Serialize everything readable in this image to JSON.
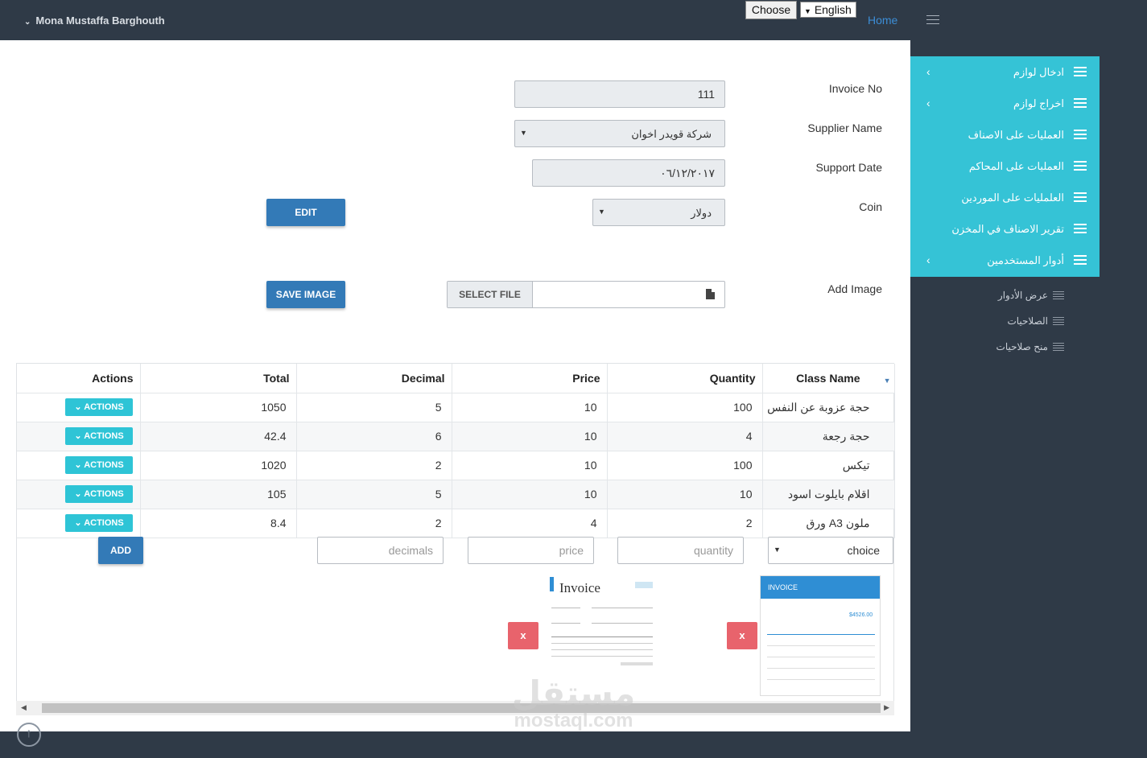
{
  "header": {
    "user_name": "Mona Mustaffa Barghouth",
    "choose_label": "Choose",
    "language": "English",
    "home_label": "Home"
  },
  "sidebar": {
    "items": [
      {
        "label": "ادخال لوازم",
        "has_arrow": true
      },
      {
        "label": "اخراج لوازم",
        "has_arrow": true
      },
      {
        "label": "العمليات على الاصناف",
        "has_arrow": false
      },
      {
        "label": "العمليات على المحاكم",
        "has_arrow": false
      },
      {
        "label": "العلمليات على الموردين",
        "has_arrow": false
      },
      {
        "label": "تقرير الاصناف في المخزن",
        "has_arrow": false
      },
      {
        "label": "أدوار المستخدمين",
        "has_arrow": true
      }
    ],
    "sub_items": [
      {
        "label": "عرض الأدوار"
      },
      {
        "label": "الصلاحيات"
      },
      {
        "label": "منح صلاحيات"
      }
    ]
  },
  "form": {
    "invoice_no_label": "Invoice No",
    "invoice_no_value": "111",
    "supplier_label": "Supplier Name",
    "supplier_value": "شركة قويدر اخوان",
    "date_label": "Support Date",
    "date_value": "٠٦/١٢/٢٠١٧",
    "coin_label": "Coin",
    "coin_value": "دولار",
    "edit_label": "EDIT",
    "add_image_label": "Add Image",
    "select_file_label": "SELECT FILE",
    "save_image_label": "SAVE IMAGE"
  },
  "table": {
    "columns": [
      "Actions",
      "Total",
      "Decimal",
      "Price",
      "Quantity",
      "Class Name"
    ],
    "rows": [
      {
        "actions": "ACTIONS",
        "total": "1050",
        "decimal": "5",
        "price": "10",
        "quantity": "100",
        "class_name": "حجة عزوبة عن النفس"
      },
      {
        "actions": "ACTIONS",
        "total": "42.4",
        "decimal": "6",
        "price": "10",
        "quantity": "4",
        "class_name": "حجة رجعة"
      },
      {
        "actions": "ACTIONS",
        "total": "1020",
        "decimal": "2",
        "price": "10",
        "quantity": "100",
        "class_name": "تيكس"
      },
      {
        "actions": "ACTIONS",
        "total": "105",
        "decimal": "5",
        "price": "10",
        "quantity": "10",
        "class_name": "اقلام بايلوت اسود"
      },
      {
        "actions": "ACTIONS",
        "total": "8.4",
        "decimal": "2",
        "price": "4",
        "quantity": "2",
        "class_name": "ورق A3 ملون"
      }
    ],
    "new_row": {
      "add_label": "ADD",
      "decimals_placeholder": "decimals",
      "price_placeholder": "price",
      "quantity_placeholder": "quantity",
      "choice_value": "choice"
    }
  },
  "images": {
    "thumb1_title": "Invoice",
    "thumb2_title": "INVOICE",
    "thumb2_amount": "$4526.00",
    "remove_label": "x"
  },
  "watermark": {
    "line1": "مستقل",
    "line2": "mostaql.com"
  }
}
